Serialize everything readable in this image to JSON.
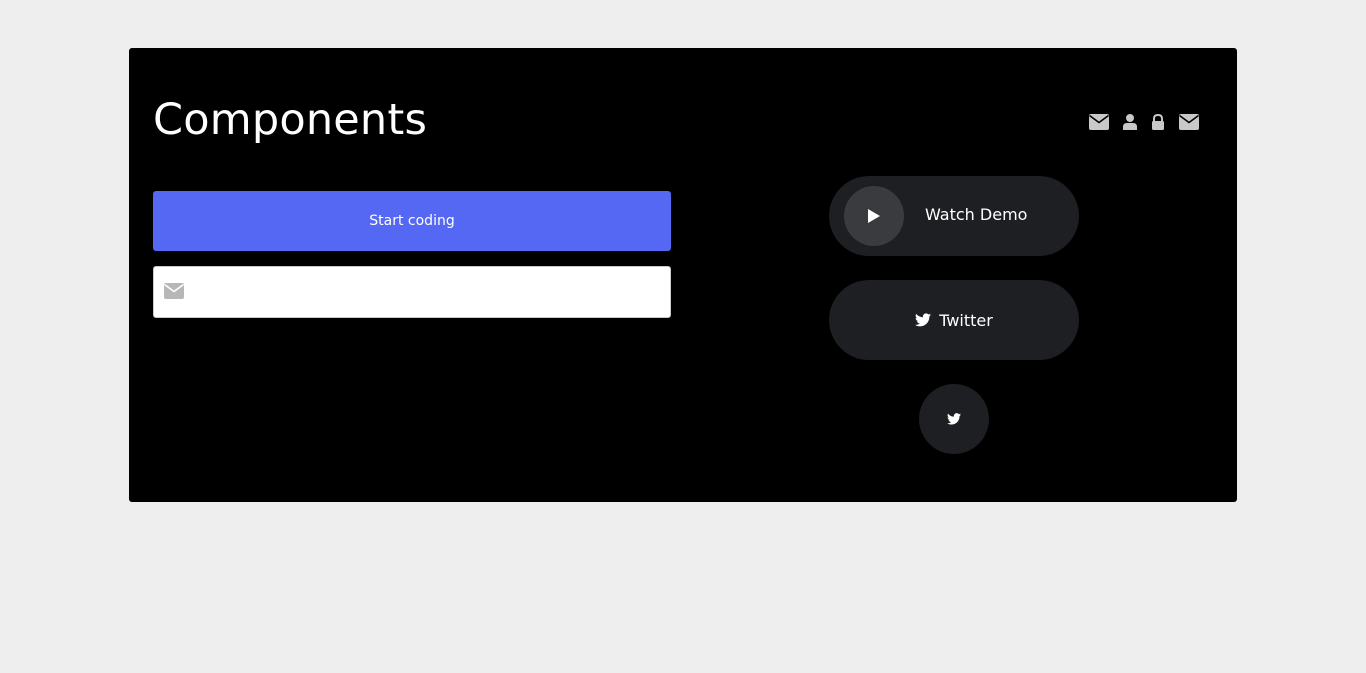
{
  "header": {
    "title": "Components",
    "icons": [
      "envelope-icon",
      "user-icon",
      "lock-icon",
      "envelope-icon"
    ]
  },
  "left": {
    "primary_button_label": "Start coding",
    "email_input": {
      "value": "",
      "placeholder": "",
      "icon": "envelope-icon"
    }
  },
  "right": {
    "watch_demo": {
      "label": "Watch Demo",
      "icon": "play-icon"
    },
    "twitter_button": {
      "label": "Twitter",
      "icon": "twitter-icon"
    },
    "twitter_round_button": {
      "icon": "twitter-icon"
    }
  },
  "colors": {
    "page_background": "#eeeeee",
    "card_background": "#000000",
    "primary": "#5468f4",
    "pill_background": "#1e1f22",
    "play_circle": "#3a3b3e",
    "icon_gray": "#c8c8c8"
  }
}
